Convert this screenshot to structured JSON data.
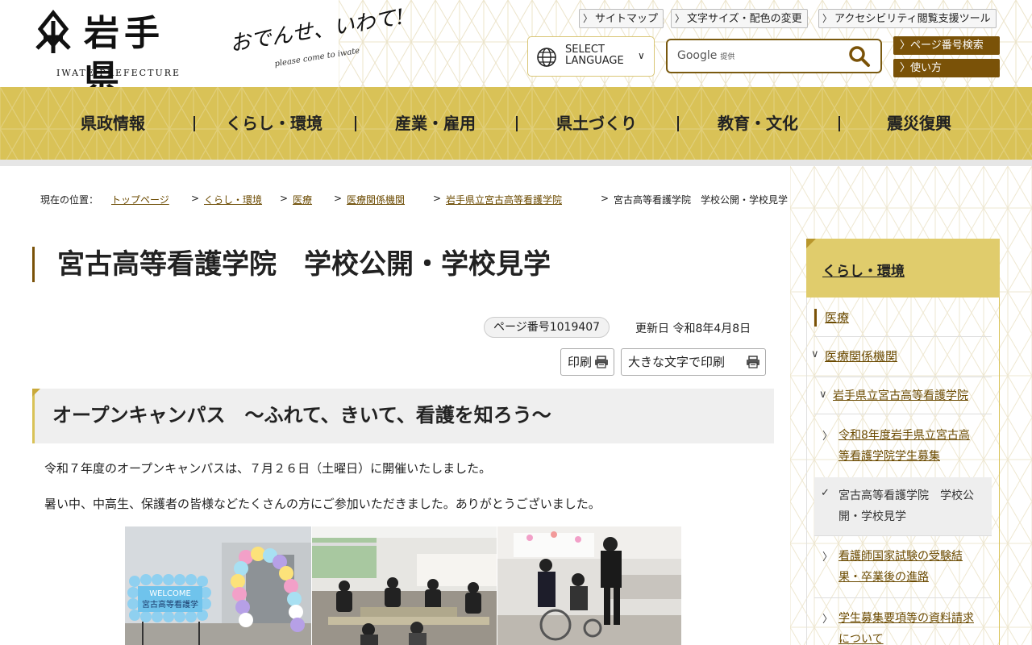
{
  "header": {
    "logo_title": "岩手県",
    "logo_subtitle": "IWATE PREFECTURE",
    "slogan": "おでんせ、いわて!",
    "slogan_sub": "please come to iwate",
    "util_links": [
      "サイトマップ",
      "文字サイズ・配色の変更",
      "アクセシビリティ閲覧支援ツール"
    ],
    "language": {
      "line1": "SELECT",
      "line2": "LANGUAGE"
    },
    "search": {
      "brand": "Google",
      "brand_suffix": "提供"
    },
    "page_number_search": "ページ番号検索",
    "how_to_use": "使い方"
  },
  "gnav": {
    "items": [
      "県政情報",
      "くらし・環境",
      "産業・雇用",
      "県土づくり",
      "教育・文化",
      "震災復興"
    ]
  },
  "breadcrumb": {
    "label": "現在の位置：",
    "items": [
      "トップページ",
      "くらし・環境",
      "医療",
      "医療関係機関",
      "岩手県立宮古高等看護学院"
    ],
    "current": "宮古高等看護学院　学校公開・学校見学"
  },
  "main": {
    "title": "宮古高等看護学院　学校公開・学校見学",
    "page_number": "ページ番号1019407",
    "updated": "更新日 令和8年4月8日",
    "print_label": "印刷",
    "print_large_label": "大きな文字で印刷",
    "section_heading": "オープンキャンパス　～ふれて、きいて、看護を知ろう～",
    "paragraphs": [
      "令和７年度のオープンキャンパスは、７月２６日（土曜日）に開催いたしました。",
      "暑い中、中高生、保護者の皆様などたくさんの方にご参加いただきました。ありがとうございました。"
    ],
    "photo_sign_top": "WELCOME",
    "photo_sign_bottom": "宮古高等看護学"
  },
  "sidebar": {
    "heading": "くらし・環境",
    "items": [
      {
        "label": "医療"
      },
      {
        "label": "医療関係機関"
      },
      {
        "label": "岩手県立宮古高等看護学院"
      },
      {
        "line1": "令和8年度岩手県立宮古高",
        "line2": "等看護学院学生募集"
      },
      {
        "line1": "宮古高等看護学院　学校公",
        "line2": "開・学校見学"
      },
      {
        "line1": "看護師国家試験の受験結",
        "line2": "果・卒業後の進路"
      },
      {
        "line1": "学生募集要項等の資料請求",
        "line2": "について"
      }
    ]
  },
  "colors": {
    "accent_gold": "#d9c257",
    "brown": "#7a5208",
    "link": "#6b4a00"
  }
}
